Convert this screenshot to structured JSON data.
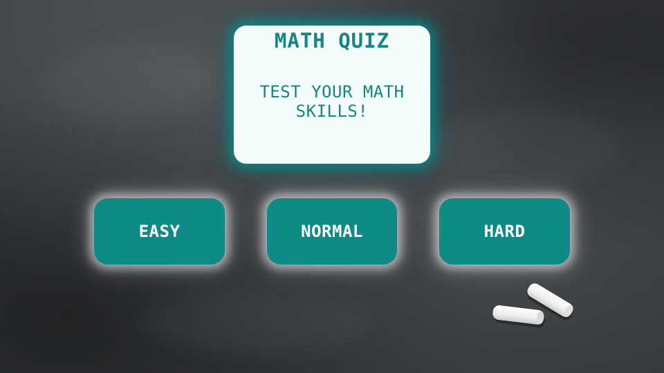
{
  "title_card": {
    "title": "MATH QUIZ",
    "subtitle": "TEST YOUR MATH SKILLS!"
  },
  "difficulty_buttons": [
    {
      "label": "EASY"
    },
    {
      "label": "NORMAL"
    },
    {
      "label": "HARD"
    }
  ],
  "colors": {
    "board": "#36393c",
    "card_background": "#f4fdfb",
    "accent_teal": "#0e8a87",
    "title_text": "#158683",
    "button_text": "#ffffff"
  },
  "decorations": [
    "chalk-pieces-icon"
  ]
}
